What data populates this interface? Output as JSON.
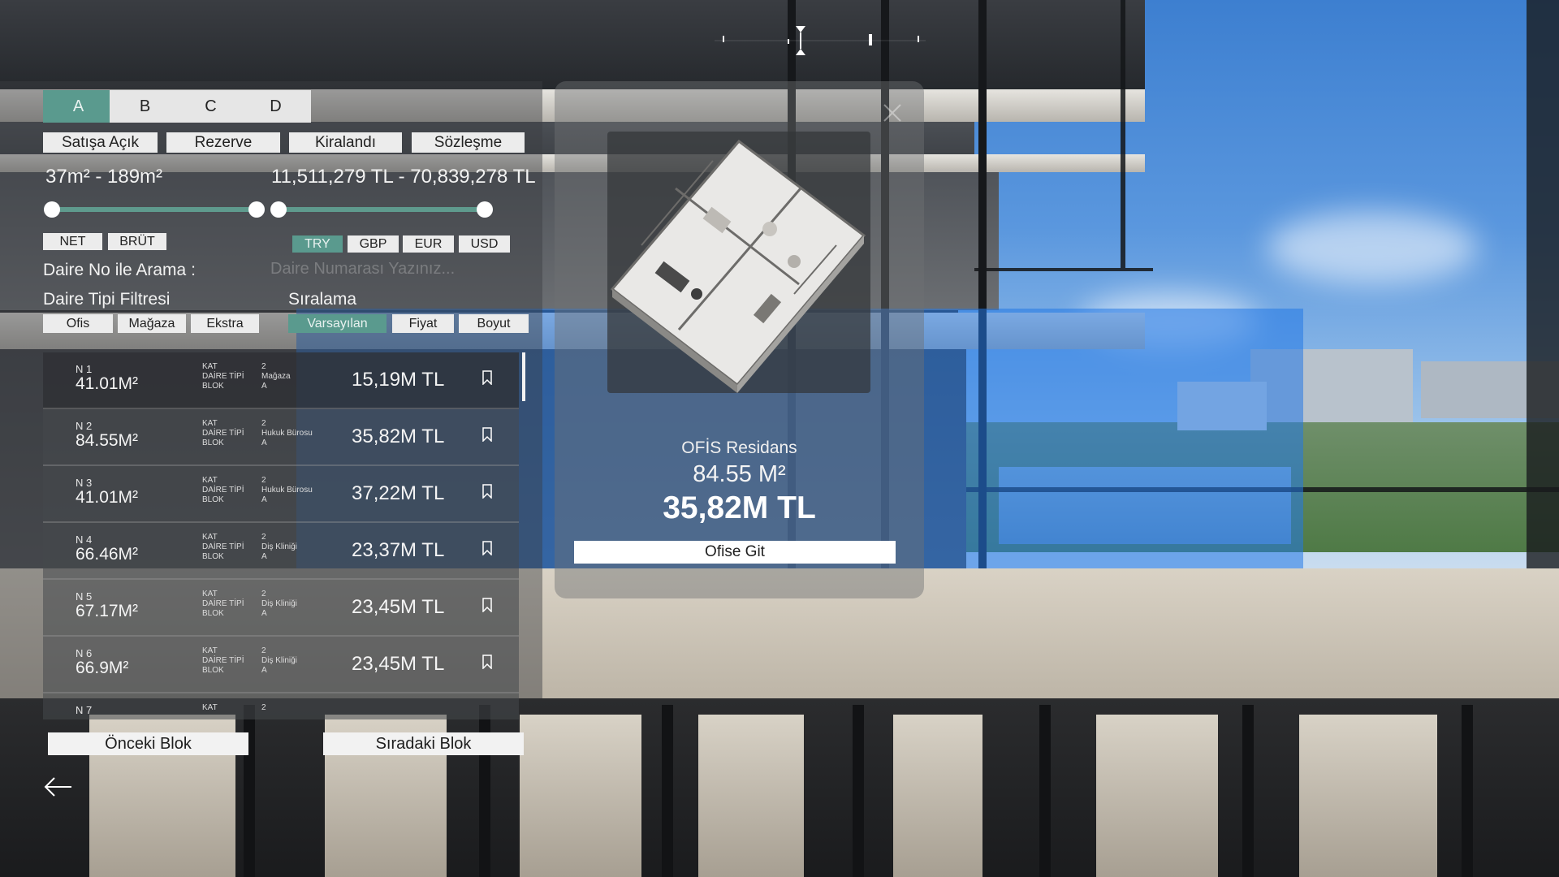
{
  "blocks": {
    "tabs": [
      "A",
      "B",
      "C",
      "D"
    ],
    "active": "A"
  },
  "status_filters": [
    "Satışa Açık",
    "Rezerve",
    "Kiralandı",
    "Sözleşme"
  ],
  "area_range": {
    "text": "37m² - 189m²",
    "min_fraction": 0.0,
    "max_fraction": 1.0
  },
  "price_range": {
    "text": "11,511,279 TL - 70,839,278 TL",
    "min_fraction": 0.0,
    "max_fraction": 1.0
  },
  "area_mode": {
    "options": [
      "NET",
      "BRÜT"
    ]
  },
  "currency": {
    "options": [
      "TRY",
      "GBP",
      "EUR",
      "USD"
    ],
    "selected": "TRY"
  },
  "search": {
    "label": "Daire No ile Arama :",
    "placeholder": "Daire Numarası Yazınız..."
  },
  "type_filter": {
    "label": "Daire Tipi Filtresi",
    "options": [
      "Ofis",
      "Mağaza",
      "Ekstra"
    ]
  },
  "sort": {
    "label": "Sıralama",
    "options": [
      "Varsayılan",
      "Fiyat",
      "Boyut"
    ],
    "selected": "Varsayılan"
  },
  "meta_labels": {
    "floor": "KAT",
    "type": "DAİRE TİPİ",
    "block": "BLOK"
  },
  "units": [
    {
      "no": "N 1",
      "area": "41.01M²",
      "floor": "2",
      "type": "Mağaza",
      "block": "A",
      "price": "15,19M TL"
    },
    {
      "no": "N 2",
      "area": "84.55M²",
      "floor": "2",
      "type": "Hukuk Bürosu",
      "block": "A",
      "price": "35,82M TL"
    },
    {
      "no": "N 3",
      "area": "41.01M²",
      "floor": "2",
      "type": "Hukuk Bürosu",
      "block": "A",
      "price": "37,22M TL"
    },
    {
      "no": "N 4",
      "area": "66.46M²",
      "floor": "2",
      "type": "Diş Kliniği",
      "block": "A",
      "price": "23,37M TL"
    },
    {
      "no": "N 5",
      "area": "67.17M²",
      "floor": "2",
      "type": "Diş Kliniği",
      "block": "A",
      "price": "23,45M TL"
    },
    {
      "no": "N 6",
      "area": "66.9M²",
      "floor": "2",
      "type": "Diş Kliniği",
      "block": "A",
      "price": "23,45M TL"
    },
    {
      "no": "N 7",
      "area": "",
      "floor": "2",
      "type": "",
      "block": "",
      "price": ""
    }
  ],
  "nav": {
    "prev": "Önceki Blok",
    "next": "Sıradaki Blok"
  },
  "detail": {
    "type": "OFİS Residans",
    "area": "84.55 M²",
    "price": "35,82M TL",
    "go_button": "Ofise Git"
  },
  "colors": {
    "accent": "#5a9a8e",
    "highlight_blue": "#2378e6"
  }
}
